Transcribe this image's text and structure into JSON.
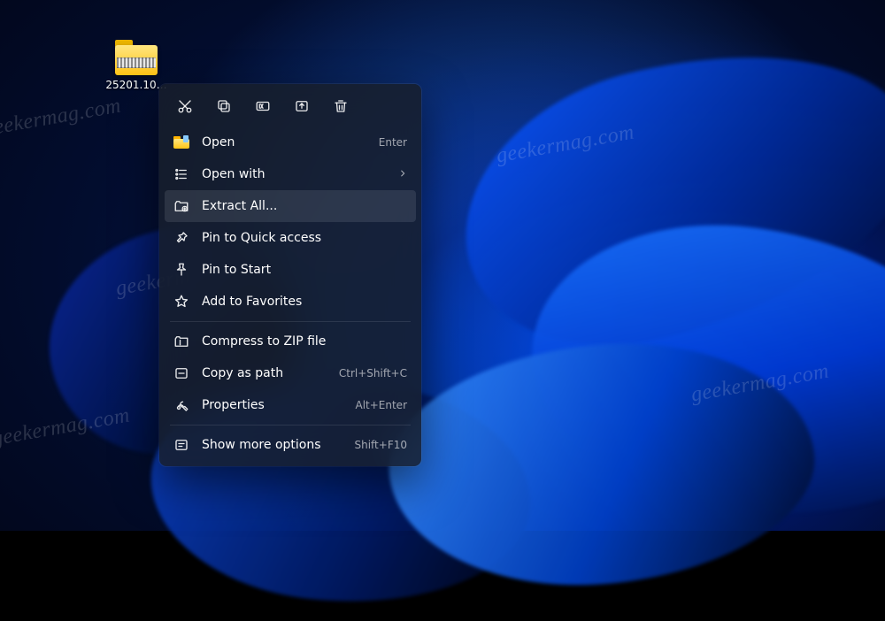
{
  "desktop": {
    "file_label": "25201.10…"
  },
  "context_menu": {
    "icon_row": [
      {
        "name": "cut-icon"
      },
      {
        "name": "copy-icon"
      },
      {
        "name": "rename-icon"
      },
      {
        "name": "share-icon"
      },
      {
        "name": "delete-icon"
      }
    ],
    "items": [
      {
        "label": "Open",
        "accel": "Enter",
        "icon": "folder-open",
        "submenu": false
      },
      {
        "label": "Open with",
        "accel": "",
        "icon": "list",
        "submenu": true
      },
      {
        "label": "Extract All...",
        "accel": "",
        "icon": "extract",
        "submenu": false,
        "highlight": true
      },
      {
        "label": "Pin to Quick access",
        "accel": "",
        "icon": "pin",
        "submenu": false
      },
      {
        "label": "Pin to Start",
        "accel": "",
        "icon": "pin-outline",
        "submenu": false
      },
      {
        "label": "Add to Favorites",
        "accel": "",
        "icon": "star",
        "submenu": false
      },
      {
        "label": "Compress to ZIP file",
        "accel": "",
        "icon": "archive",
        "submenu": false
      },
      {
        "label": "Copy as path",
        "accel": "Ctrl+Shift+C",
        "icon": "path",
        "submenu": false
      },
      {
        "label": "Properties",
        "accel": "Alt+Enter",
        "icon": "wrench",
        "submenu": false
      },
      {
        "label": "Show more options",
        "accel": "Shift+F10",
        "icon": "more",
        "submenu": false
      }
    ]
  },
  "watermark": "geekermag.com"
}
